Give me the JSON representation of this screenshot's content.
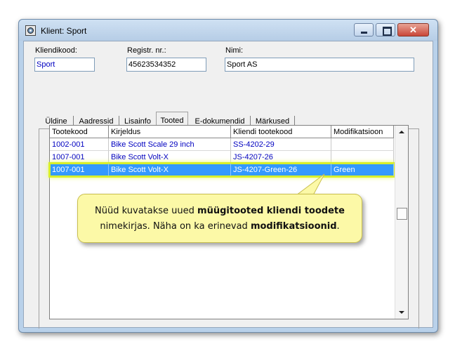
{
  "window": {
    "title": "Klient: Sport"
  },
  "fields": {
    "kood": {
      "label": "Kliendikood:",
      "value": "Sport"
    },
    "registr": {
      "label": "Registr. nr.:",
      "value": "45623534352"
    },
    "nimi": {
      "label": "Nimi:",
      "value": "Sport AS"
    }
  },
  "tabs": [
    {
      "label": "Üldine"
    },
    {
      "label": "Aadressid"
    },
    {
      "label": "Lisainfo"
    },
    {
      "label": "Tooted"
    },
    {
      "label": "E-dokumendid"
    },
    {
      "label": "Märkused"
    }
  ],
  "active_tab": "Tooted",
  "table": {
    "columns": [
      "Tootekood",
      "Kirjeldus",
      "Kliendi tootekood",
      "Modifikatsioon"
    ],
    "rows": [
      {
        "tootekood": "1002-001",
        "kirjeldus": "Bike Scott Scale 29 inch",
        "kliendi_tootekood": "SS-4202-29",
        "modifikatsioon": ""
      },
      {
        "tootekood": "1007-001",
        "kirjeldus": "Bike Scott Volt-X",
        "kliendi_tootekood": "JS-4207-26",
        "modifikatsioon": ""
      },
      {
        "tootekood": "1007-001",
        "kirjeldus": "Bike Scott Volt-X",
        "kliendi_tootekood": "JS-4207-Green-26",
        "modifikatsioon": "Green"
      }
    ],
    "selected_row": 3
  },
  "callout": {
    "line1_a": "Nüüd kuvatakse uued ",
    "line1_b": "müügitooted kliendi toodete",
    "line2_a": "nimekirjas.  Näha on ka erinevad ",
    "line2_b": "modifikatsioonid",
    "line2_c": "."
  },
  "colors": {
    "selection": "#3399ff",
    "highlight_outline": "#d8ef2a",
    "link_text": "#0000c0",
    "callout_bg": "#fcf9a7",
    "close_button": "#c9473a"
  }
}
